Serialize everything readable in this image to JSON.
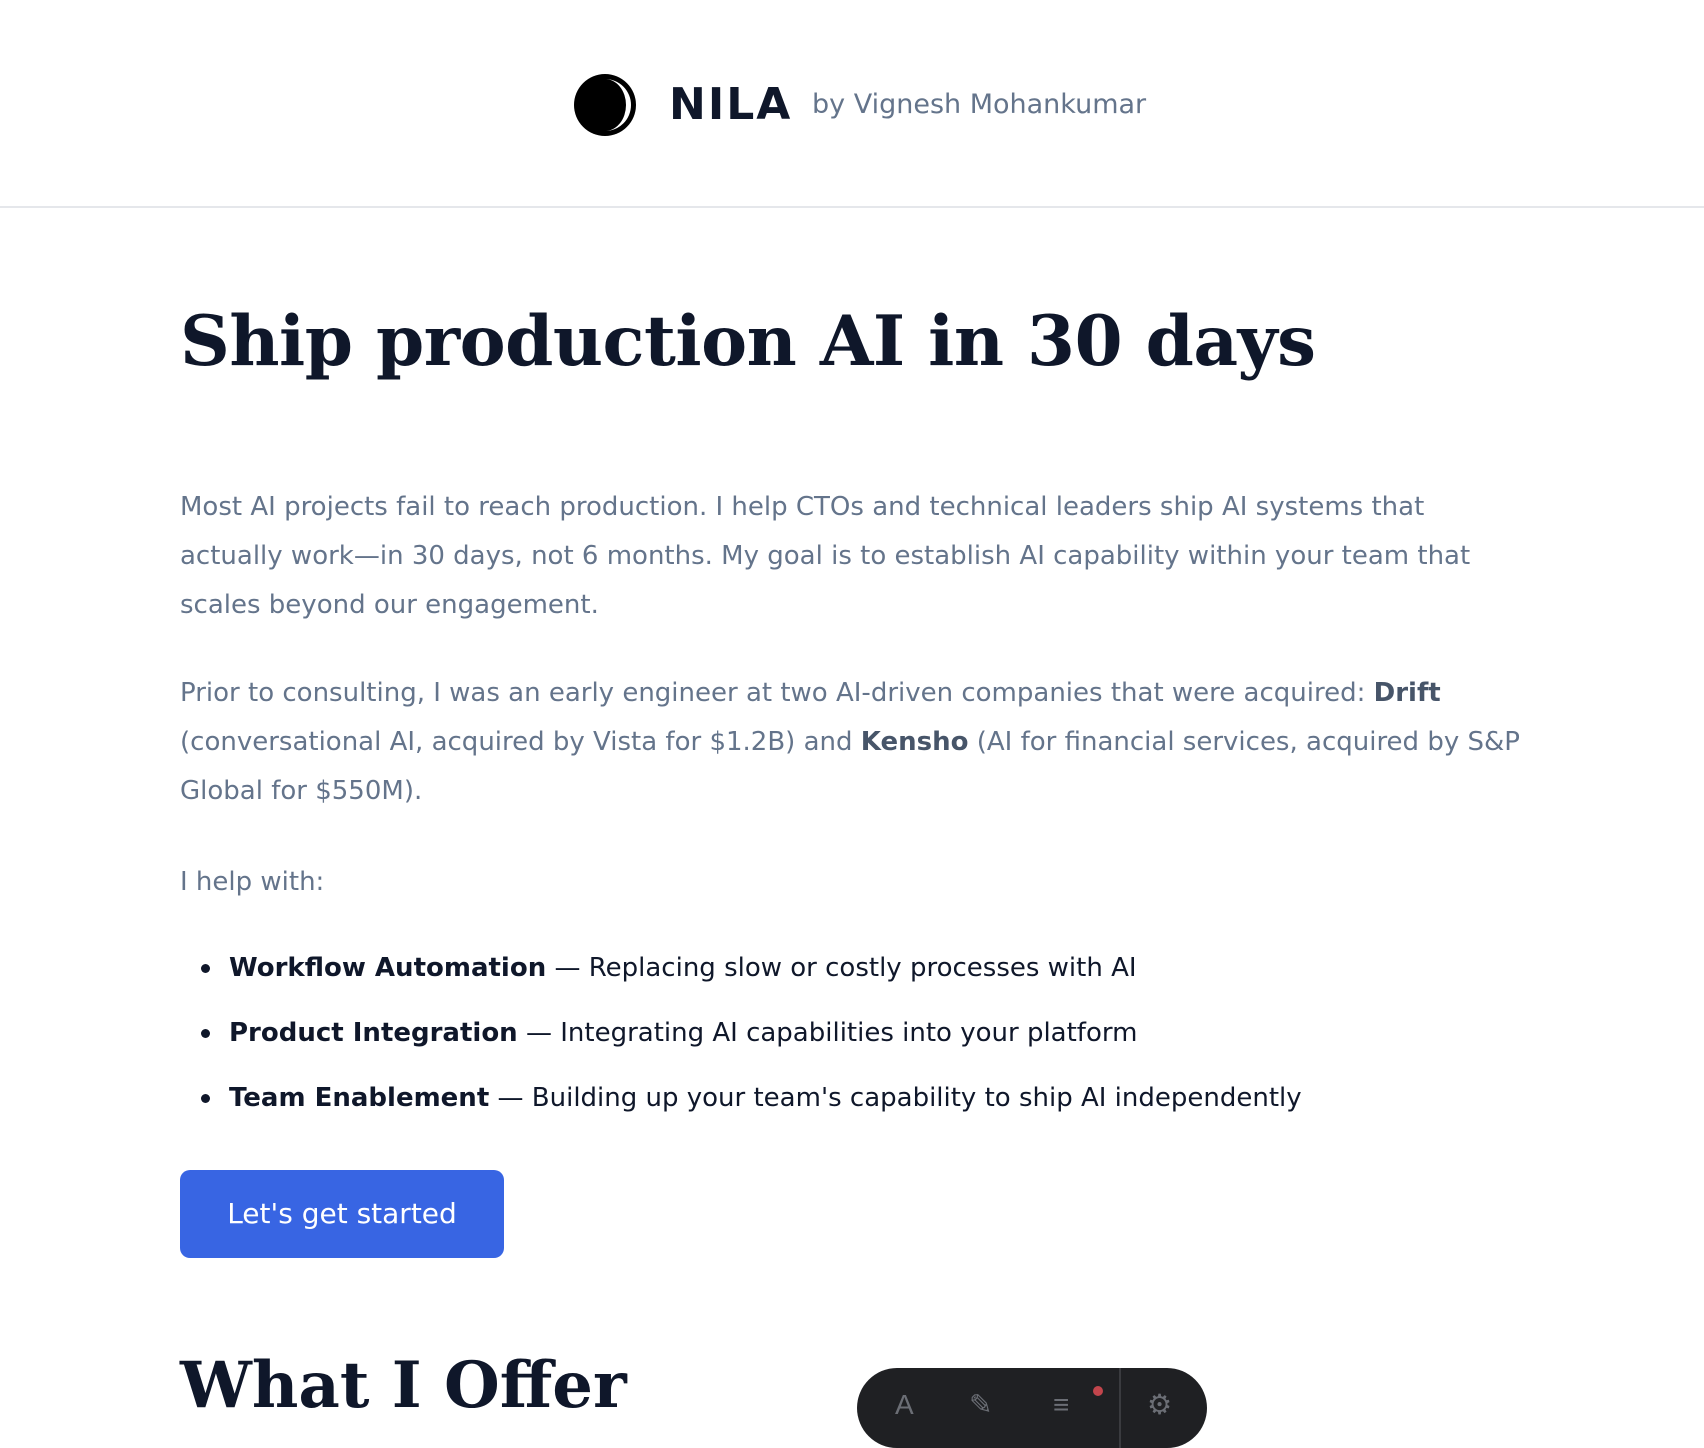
{
  "header": {
    "brand": "NILA",
    "byline": "by Vignesh Mohankumar",
    "logo_icon": "crescent-moon-icon"
  },
  "hero": {
    "title": "Ship production AI in 30 days"
  },
  "intro": {
    "paragraph1": "Most AI projects fail to reach production. I help CTOs and technical leaders ship AI systems that actually work—in 30 days, not 6 months. My goal is to establish AI capability within your team that scales beyond our engagement.",
    "p2_before": "Prior to consulting, I was an early engineer at two AI-driven companies that were acquired: ",
    "p2_company1": "Drift",
    "p2_middle": " (conversational AI, acquired by Vista for $1.2B) and ",
    "p2_company2": "Kensho",
    "p2_after": " (AI for financial services, acquired by S&P Global for $550M).",
    "help_with": "I help with:"
  },
  "services": [
    {
      "name": "Workflow Automation",
      "description": " — Replacing slow or costly processes with AI"
    },
    {
      "name": "Product Integration",
      "description": " — Integrating AI capabilities into your platform"
    },
    {
      "name": "Team Enablement",
      "description": " — Building up your team's capability to ship AI independently"
    }
  ],
  "cta": {
    "label": "Let's get started"
  },
  "offer": {
    "title": "What I Offer"
  },
  "toolbar": {
    "icons": [
      "text-icon",
      "pen-icon",
      "menu-icon",
      "settings-icon"
    ],
    "glyphs": [
      "A",
      "✎",
      "≡",
      "⚙"
    ],
    "notification_color": "#c2454c"
  },
  "colors": {
    "accent": "#3865e3",
    "heading": "#0f172a",
    "muted": "#64748b"
  }
}
